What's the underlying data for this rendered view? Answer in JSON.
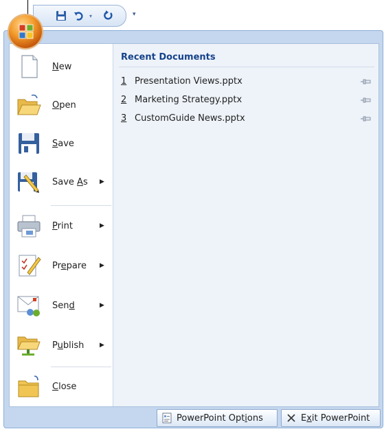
{
  "quick_access": {
    "items": [
      "save-icon",
      "undo-icon",
      "redo-icon"
    ],
    "customize_arrow": "▾"
  },
  "office_button": {
    "icon": "office-logo"
  },
  "commands": [
    {
      "label_pre": "",
      "label_ul": "N",
      "label_post": "ew",
      "submenu": false,
      "icon": "new-document-icon"
    },
    {
      "label_pre": "",
      "label_ul": "O",
      "label_post": "pen",
      "submenu": false,
      "icon": "open-folder-icon"
    },
    {
      "label_pre": "",
      "label_ul": "S",
      "label_post": "ave",
      "submenu": false,
      "icon": "save-icon"
    },
    {
      "label_pre": "Save ",
      "label_ul": "A",
      "label_post": "s",
      "submenu": true,
      "icon": "save-as-icon"
    },
    {
      "label_pre": "",
      "label_ul": "P",
      "label_post": "rint",
      "submenu": true,
      "icon": "printer-icon"
    },
    {
      "label_pre": "Pr",
      "label_ul": "e",
      "label_post": "pare",
      "submenu": true,
      "icon": "prepare-icon"
    },
    {
      "label_pre": "Sen",
      "label_ul": "d",
      "label_post": "",
      "submenu": true,
      "icon": "send-icon"
    },
    {
      "label_pre": "P",
      "label_ul": "u",
      "label_post": "blish",
      "submenu": true,
      "icon": "publish-icon"
    },
    {
      "label_pre": "",
      "label_ul": "C",
      "label_post": "lose",
      "submenu": false,
      "icon": "close-folder-icon"
    }
  ],
  "submenu_arrow": "▶",
  "recent": {
    "title": "Recent Documents",
    "items": [
      {
        "num": "1",
        "name": "Presentation Views.pptx"
      },
      {
        "num": "2",
        "name": "Marketing Strategy.pptx"
      },
      {
        "num": "3",
        "name": "CustomGuide News.pptx"
      }
    ]
  },
  "bottom": {
    "options_pre": "PowerPoint Opt",
    "options_ul": "i",
    "options_post": "ons",
    "exit_pre": "E",
    "exit_ul": "x",
    "exit_post": "it PowerPoint"
  },
  "colors": {
    "accent": "#15428b",
    "frame": "#c4d7ee",
    "panel": "#eef3f9",
    "orb": "#f39a2a"
  }
}
